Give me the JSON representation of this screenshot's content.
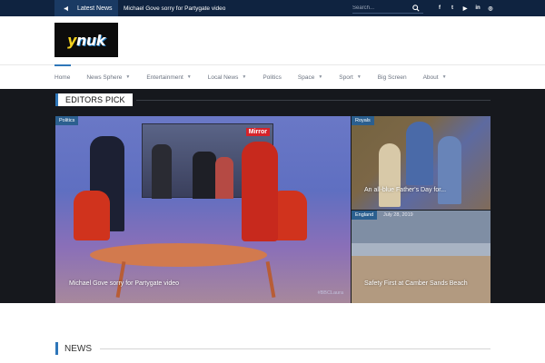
{
  "topbar": {
    "latest_label": "Latest News",
    "ticker_text": "Michael Gove sorry for Partygate video",
    "search_placeholder": "Search...",
    "socials": [
      {
        "icon": "facebook-icon",
        "glyph": "f"
      },
      {
        "icon": "twitter-icon",
        "glyph": "t"
      },
      {
        "icon": "youtube-icon",
        "glyph": "▶"
      },
      {
        "icon": "linkedin-icon",
        "glyph": "in"
      },
      {
        "icon": "instagram-icon",
        "glyph": "◎"
      }
    ]
  },
  "header": {
    "logo_y": "y",
    "logo_rest": "nuk"
  },
  "nav": {
    "items": [
      {
        "label": "Home",
        "dropdown": false
      },
      {
        "label": "News Sphere",
        "dropdown": true
      },
      {
        "label": "Entertainment",
        "dropdown": true
      },
      {
        "label": "Local News",
        "dropdown": true
      },
      {
        "label": "Politics",
        "dropdown": false
      },
      {
        "label": "Space",
        "dropdown": true
      },
      {
        "label": "Sport",
        "dropdown": true
      },
      {
        "label": "Big Screen",
        "dropdown": false
      },
      {
        "label": "About",
        "dropdown": true
      }
    ]
  },
  "editors_pick": {
    "title": "EDITORS PICK",
    "main": {
      "tag": "Politics",
      "caption": "Michael Gove sorry for Partygate video",
      "screen_label": "Mirror",
      "watermark": "#BBCLaura"
    },
    "right_top": {
      "tag": "Royals",
      "caption": "An all-blue Father's Day for..."
    },
    "right_bottom": {
      "tag": "England",
      "date": "July 28, 2019",
      "caption": "Safety First at Camber Sands Beach"
    }
  },
  "news": {
    "title": "NEWS"
  },
  "colors": {
    "topbar": "#0f2340",
    "accent": "#2e76b9",
    "dark_section": "#16181d"
  }
}
